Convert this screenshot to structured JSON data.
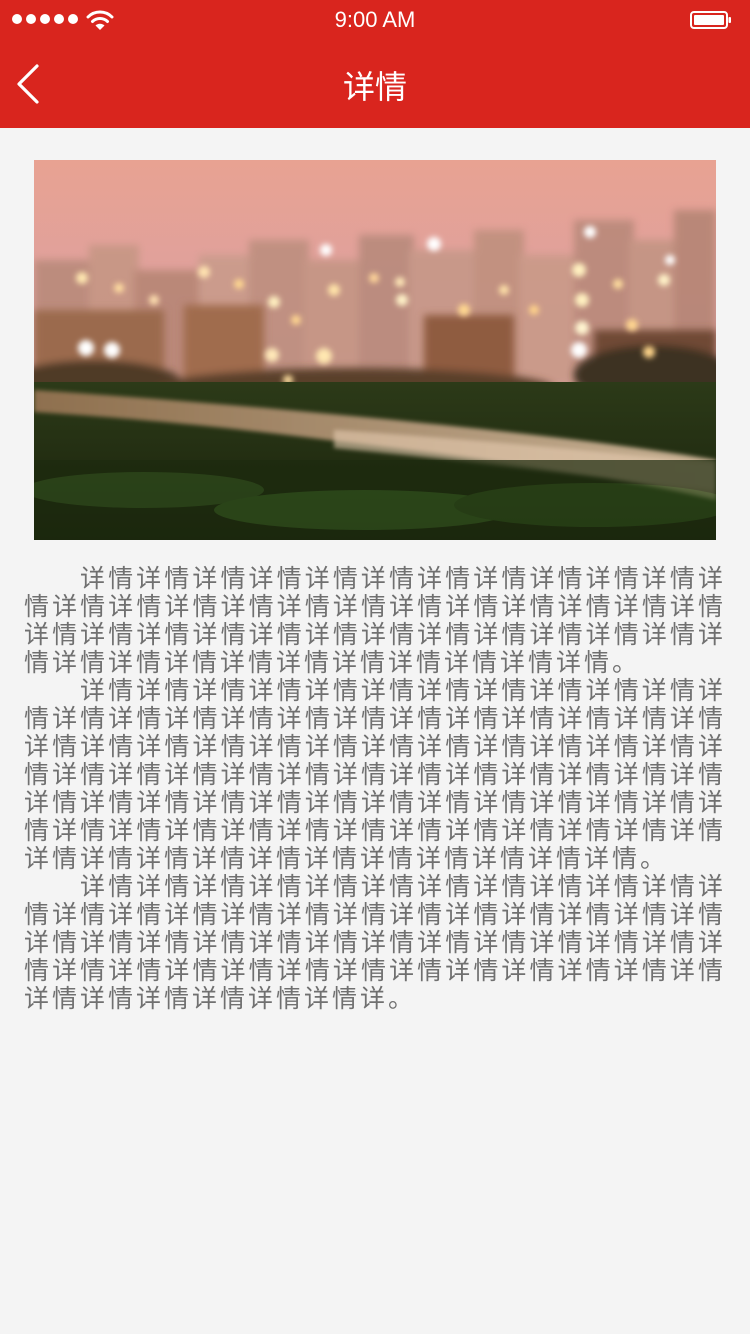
{
  "status_bar": {
    "time": "9:00 AM",
    "signal_icon": "signal-dots-icon",
    "wifi_icon": "wifi-icon",
    "battery_icon": "battery-icon"
  },
  "nav": {
    "back_icon": "chevron-left-icon",
    "title": "详情"
  },
  "hero_image": {
    "subject": "blurred city lights at dusk over a grass field with a white line"
  },
  "article": {
    "paragraphs": [
      "详情详情详情详情详情详情详情详情详情详情详情详情详情详情详情详情详情详情详情详情详情详情详情详情详情详情详情详情详情详情详情详情详情详情详情详情详情详情详情详情详情详情详情详情详情详情详情。",
      "详情详情详情详情详情详情详情详情详情详情详情详情详情详情详情详情详情详情详情详情详情详情详情详情详情详情详情详情详情详情详情详情详情详情详情详情详情详情详情详情详情详情详情详情详情详情详情详情详情详情详情详情详情详情详情详情详情详情详情详情详情详情详情详情详情详情详情详情详情详情详情详情详情详情详情详情详情详情详情详情详情详情详情详情详情。",
      "详情详情详情详情详情详情详情详情详情详情详情详情详情详情详情详情详情详情详情详情详情详情详情详情详情详情详情详情详情详情详情详情详情详情详情详情详情详情详情详情详情详情详情详情详情详情详情详情详情详情详情详情详情详情详情详。"
    ]
  },
  "colors": {
    "accent": "#d9251e",
    "background": "#f4f4f4",
    "body_text": "#707070"
  }
}
